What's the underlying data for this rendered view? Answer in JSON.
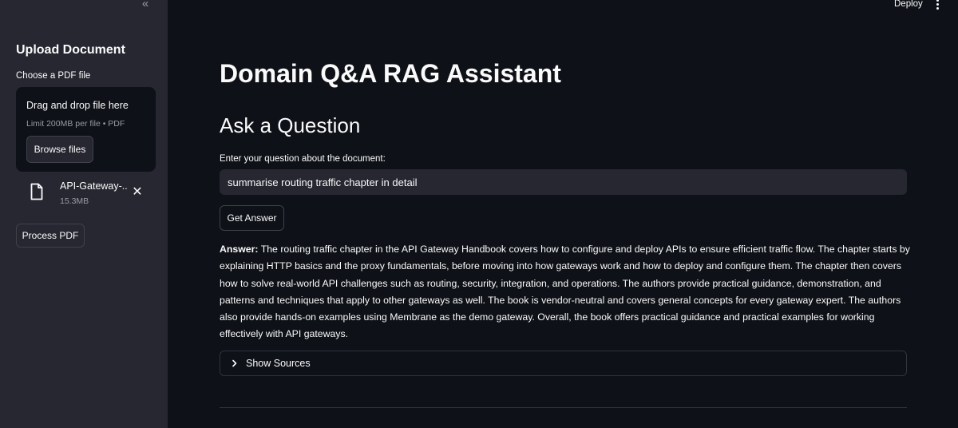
{
  "sidebar": {
    "collapse_glyph": "«",
    "title": "Upload Document",
    "uploader_label": "Choose a PDF file",
    "dropzone": {
      "main_text": "Drag and drop file here",
      "limit_text": "Limit 200MB per file • PDF",
      "browse_label": "Browse files"
    },
    "file": {
      "icon": "file-icon",
      "name": "API-Gateway-...",
      "size": "15.3MB",
      "remove_glyph": "✕"
    },
    "process_label": "Process PDF"
  },
  "header": {
    "deploy_label": "Deploy",
    "menu_icon": "vertical-dots-icon"
  },
  "main": {
    "title": "Domain Q&A RAG Assistant",
    "section_title": "Ask a Question",
    "question_label": "Enter your question about the document:",
    "question_value": "summarise routing traffic chapter in detail",
    "get_answer_label": "Get Answer",
    "answer_prefix": "Answer:",
    "answer_text": " The routing traffic chapter in the API Gateway Handbook covers how to configure and deploy APIs to ensure efficient traffic flow. The chapter starts by explaining HTTP basics and the proxy fundamentals, before moving into how gateways work and how to deploy and configure them. The chapter then covers how to solve real-world API challenges such as routing, security, integration, and operations. The authors provide practical guidance, demonstration, and patterns and techniques that apply to other gateways as well. The book is vendor-neutral and covers general concepts for every gateway expert. The authors also provide hands-on examples using Membrane as the demo gateway. Overall, the book offers practical guidance and practical examples for working effectively with API gateways.",
    "sources_label": "Show Sources"
  },
  "colors": {
    "background": "#0e1117",
    "sidebar": "#262730",
    "text": "#fafafa",
    "muted": "#9a9ba3",
    "border": "#3f414b"
  }
}
